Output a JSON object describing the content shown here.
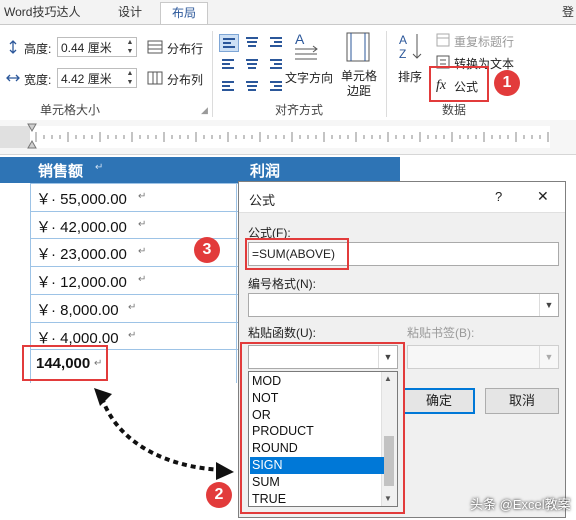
{
  "ribbon": {
    "app_tab": "Word技巧达人",
    "tabs": [
      "设计",
      "布局"
    ],
    "active_tab": "布局",
    "cell_size": {
      "height_label": "高度:",
      "height_value": "0.44 厘米",
      "width_label": "宽度:",
      "width_value": "4.42 厘米",
      "distribute_rows": "分布行",
      "distribute_cols": "分布列",
      "group_label": "单元格大小"
    },
    "alignment": {
      "text_direction": "文字方向",
      "cell_margins_line1": "单元格",
      "cell_margins_line2": "边距",
      "group_label": "对齐方式"
    },
    "data": {
      "sort": "排序",
      "repeat_header": "重复标题行",
      "convert_text": "转换为文本",
      "formula": "公式",
      "formula_fx": "fx",
      "group_label": "数据"
    },
    "edge_char": "登"
  },
  "table": {
    "headers": [
      "销售额",
      "利润"
    ],
    "header_mark": "↵",
    "rows": [
      "￥· 55,000.00",
      "￥· 42,000.00",
      "￥· 23,000.00",
      "￥· 12,000.00",
      "￥· 8,000.00",
      "￥· 4,000.00"
    ],
    "total": "144,000",
    "para_mark": "↵"
  },
  "dialog": {
    "title": "公式",
    "help": "?",
    "close": "✕",
    "formula_label": "公式(F):",
    "formula_value": "=SUM(ABOVE)",
    "number_format_label": "编号格式(N):",
    "number_format_value": "",
    "paste_function_label": "粘贴函数(U):",
    "paste_bookmark_label": "粘贴书签(B):",
    "paste_function_value": "",
    "functions": [
      "MOD",
      "NOT",
      "OR",
      "PRODUCT",
      "ROUND",
      "SIGN",
      "SUM",
      "TRUE"
    ],
    "selected_function": "SIGN",
    "ok": "确定",
    "cancel": "取消"
  },
  "annotations": {
    "step1": "1",
    "step2": "2",
    "step3": "3",
    "color": "#e23b3b"
  },
  "watermark": "头条 @Excel教案",
  "colors": {
    "header_blue": "#2e74b5",
    "accent": "#2b579a",
    "selection": "#0078d7"
  }
}
